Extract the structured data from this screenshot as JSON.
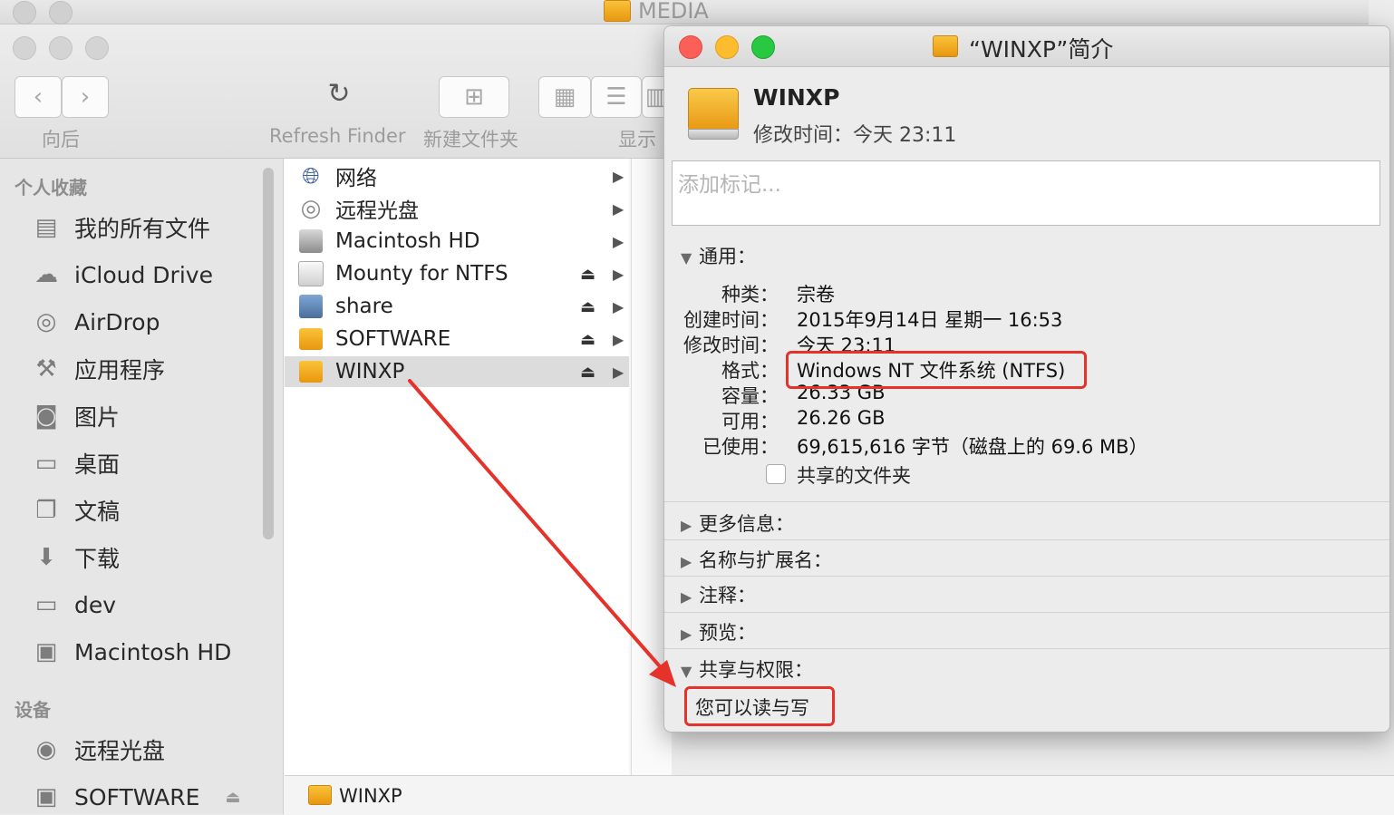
{
  "background_window": {
    "title": "MEDIA"
  },
  "toolbar": {
    "back_label": "向后",
    "refresh_label": "Refresh Finder",
    "new_folder_label": "新建文件夹",
    "view_label": "显示"
  },
  "sidebar": {
    "favorites_title": "个人收藏",
    "favorites": [
      {
        "label": "我的所有文件",
        "icon": "all-files-icon"
      },
      {
        "label": "iCloud Drive",
        "icon": "cloud-icon"
      },
      {
        "label": "AirDrop",
        "icon": "airdrop-icon"
      },
      {
        "label": "应用程序",
        "icon": "applications-icon"
      },
      {
        "label": "图片",
        "icon": "camera-icon"
      },
      {
        "label": "桌面",
        "icon": "desktop-icon"
      },
      {
        "label": "文稿",
        "icon": "documents-icon"
      },
      {
        "label": "下载",
        "icon": "download-icon"
      },
      {
        "label": "dev",
        "icon": "folder-icon"
      },
      {
        "label": "Macintosh HD",
        "icon": "hard-drive-icon"
      }
    ],
    "devices_title": "设备",
    "devices": [
      {
        "label": "远程光盘",
        "icon": "disc-icon"
      },
      {
        "label": "SOFTWARE",
        "icon": "drive-icon"
      }
    ]
  },
  "column": {
    "items": [
      {
        "label": "网络",
        "icon": "network-icon",
        "eject": false
      },
      {
        "label": "远程光盘",
        "icon": "disc-icon",
        "eject": false
      },
      {
        "label": "Macintosh HD",
        "icon": "hard-drive-icon",
        "eject": false
      },
      {
        "label": "Mounty for NTFS",
        "icon": "drive-icon",
        "eject": true
      },
      {
        "label": "share",
        "icon": "network-drive-icon",
        "eject": true
      },
      {
        "label": "SOFTWARE",
        "icon": "drive-icon",
        "eject": true
      },
      {
        "label": "WINXP",
        "icon": "drive-icon",
        "eject": true,
        "selected": true
      }
    ]
  },
  "path_bar": {
    "item": "WINXP"
  },
  "info_window": {
    "title": "“WINXP”简介",
    "name": "WINXP",
    "modified_summary": "修改时间：今天 23:11",
    "tags_placeholder": "添加标记...",
    "general_title": "通用：",
    "general": [
      {
        "key": "种类：",
        "value": "宗卷"
      },
      {
        "key": "创建时间：",
        "value": "2015年9月14日 星期一 16:53"
      },
      {
        "key": "修改时间：",
        "value": "今天 23:11"
      },
      {
        "key": "格式：",
        "value": "Windows NT 文件系统 (NTFS)"
      },
      {
        "key": "容量：",
        "value": "26.33 GB"
      },
      {
        "key": "可用：",
        "value": "26.26 GB"
      },
      {
        "key": "已使用：",
        "value": "69,615,616 字节（磁盘上的 69.6 MB）"
      }
    ],
    "shared_folder_label": "共享的文件夹",
    "more_info": "更多信息：",
    "name_ext": "名称与扩展名：",
    "comments": "注释：",
    "preview": "预览：",
    "sharing_title": "共享与权限：",
    "permission": "您可以读与写"
  },
  "colors": {
    "annotation": "#e5322b",
    "close": "#fc5f57",
    "minimize": "#fdbc2e",
    "zoom": "#28c840"
  }
}
